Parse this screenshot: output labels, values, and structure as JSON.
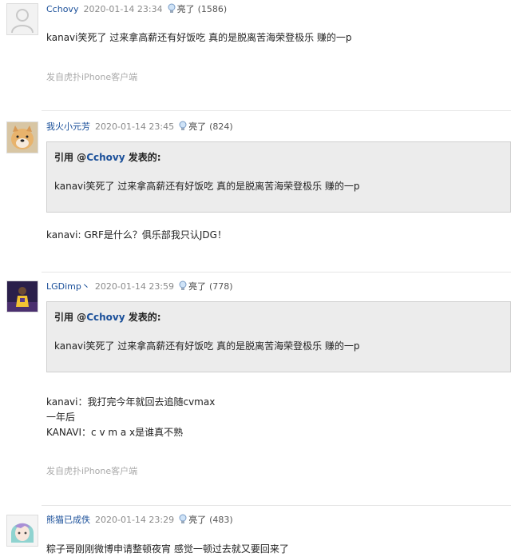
{
  "light_label": "亮了",
  "posts": [
    {
      "user": "Cchovy",
      "time": "2020-01-14 23:34",
      "count": "(1586)",
      "content": "kanavi笑死了 过来拿高薪还有好饭吃 真的是脱离苦海荣登极乐 赚的一p",
      "source": "发自虎扑iPhone客户端"
    },
    {
      "user": "我火小元芳",
      "time": "2020-01-14 23:45",
      "count": "(824)",
      "quote": {
        "prefix": "引用 @",
        "quoted_user": "Cchovy",
        "suffix": " 发表的:",
        "text": "kanavi笑死了 过来拿高薪还有好饭吃 真的是脱离苦海荣登极乐 赚的一p"
      },
      "content": "kanavi: GRF是什么？俱乐部我只认JDG！"
    },
    {
      "user": "LGDimp丶",
      "time": "2020-01-14 23:59",
      "count": "(778)",
      "quote": {
        "prefix": "引用 @",
        "quoted_user": "Cchovy",
        "suffix": " 发表的:",
        "text": "kanavi笑死了 过来拿高薪还有好饭吃 真的是脱离苦海荣登极乐 赚的一p"
      },
      "content_lines": [
        "kanavi：我打完今年就回去追随cvmax",
        "一年后",
        "KANAVI：c v m a x是谁真不熟"
      ],
      "source": "发自虎扑iPhone客户端"
    },
    {
      "user": "熊猫已成佚",
      "time": "2020-01-14 23:29",
      "count": "(483)",
      "content": "粽子哥刚刚微博申请整顿夜宵 感觉一顿过去就又要回来了"
    }
  ],
  "colors": {
    "username": "#1a4f99",
    "quote_bg": "#ececec",
    "separator": "#e6e6e6"
  },
  "icons": [
    "default-avatar-icon",
    "lightbulb-icon"
  ]
}
